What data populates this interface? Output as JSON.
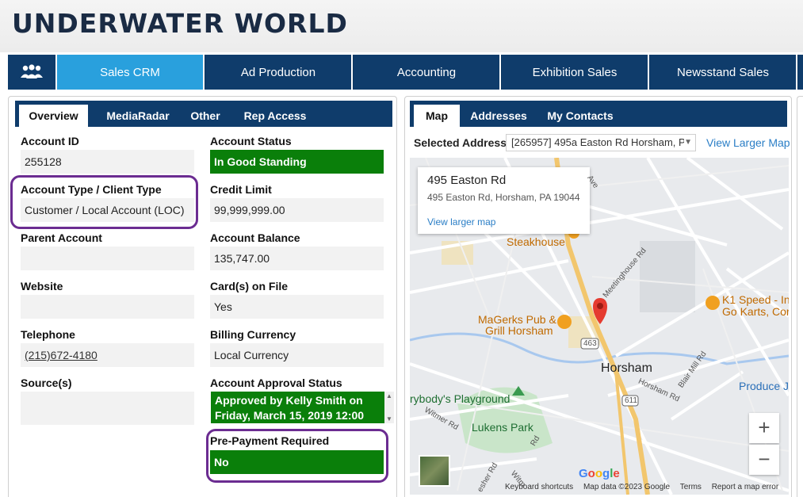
{
  "app_title": "UNDERWATER WORLD",
  "nav": {
    "icon": "people-group-icon",
    "tabs": [
      "Sales CRM",
      "Ad Production",
      "Accounting",
      "Exhibition Sales",
      "Newsstand Sales"
    ],
    "active_index": 0
  },
  "left_panel": {
    "tabs": [
      "Overview",
      "MediaRadar",
      "Other",
      "Rep Access"
    ],
    "active_tab": "Overview",
    "fields": {
      "account_id": {
        "label": "Account ID",
        "value": "255128"
      },
      "account_type": {
        "label": "Account Type / Client Type",
        "value": "Customer / Local Account (LOC)"
      },
      "parent_account": {
        "label": "Parent Account",
        "value": ""
      },
      "website": {
        "label": "Website",
        "value": ""
      },
      "telephone": {
        "label": "Telephone",
        "value": "(215)672-4180"
      },
      "sources": {
        "label": "Source(s)",
        "value": ""
      },
      "account_status": {
        "label": "Account Status",
        "value": "In Good Standing"
      },
      "credit_limit": {
        "label": "Credit Limit",
        "value": "99,999,999.00"
      },
      "account_balance": {
        "label": "Account Balance",
        "value": "135,747.00"
      },
      "cards_on_file": {
        "label": "Card(s) on File",
        "value": "Yes"
      },
      "billing_currency": {
        "label": "Billing Currency",
        "value": "Local Currency"
      },
      "approval_status": {
        "label": "Account Approval Status",
        "value": "Approved by Kelly Smith on Friday, March 15, 2019 12:00"
      },
      "prepayment": {
        "label": "Pre-Payment Required",
        "value": "No"
      }
    }
  },
  "right_panel": {
    "tabs": [
      "Map",
      "Addresses",
      "My Contacts"
    ],
    "active_tab": "Map",
    "selected_address_label": "Selected Address",
    "selected_address_value": "[265957] 495a Easton Rd Horsham, P...",
    "view_larger_map": "View Larger Map",
    "map": {
      "infobox_title": "495 Easton Rd",
      "infobox_address": "495 Easton Rd, Horsham, PA 19044",
      "infobox_link": "View larger map",
      "labels": {
        "steakhouse": "Steakhouse",
        "magerks": "MaGerks Pub &",
        "grill": "Grill Horsham",
        "horsham": "Horsham",
        "k1": "K1 Speed - Ind",
        "gokarts": "Go Karts, Cor",
        "playground": "rybody's Playground",
        "lukens": "Lukens Park",
        "produce": "Produce J",
        "meetinghouse": "Meetinghouse Rd",
        "horsham_rd": "Horsham Rd",
        "blair_mill": "Blair Mill Rd",
        "witmer": "Witmer Rd",
        "ave": "Ave",
        "rd": "Rd",
        "r463": "463",
        "r611": "611",
        "esher": "esher Rd",
        "witm": "Witm"
      },
      "zoom_in": "+",
      "zoom_out": "−",
      "google": "Google",
      "footer": [
        "Keyboard shortcuts",
        "Map data ©2023 Google",
        "Terms",
        "Report a map error"
      ]
    }
  },
  "colors": {
    "nav_bg": "#0f3c6b",
    "nav_active": "#29a0dd",
    "status_green": "#0a7f0a",
    "highlight": "#6b2c91",
    "link": "#2a7ec6"
  }
}
